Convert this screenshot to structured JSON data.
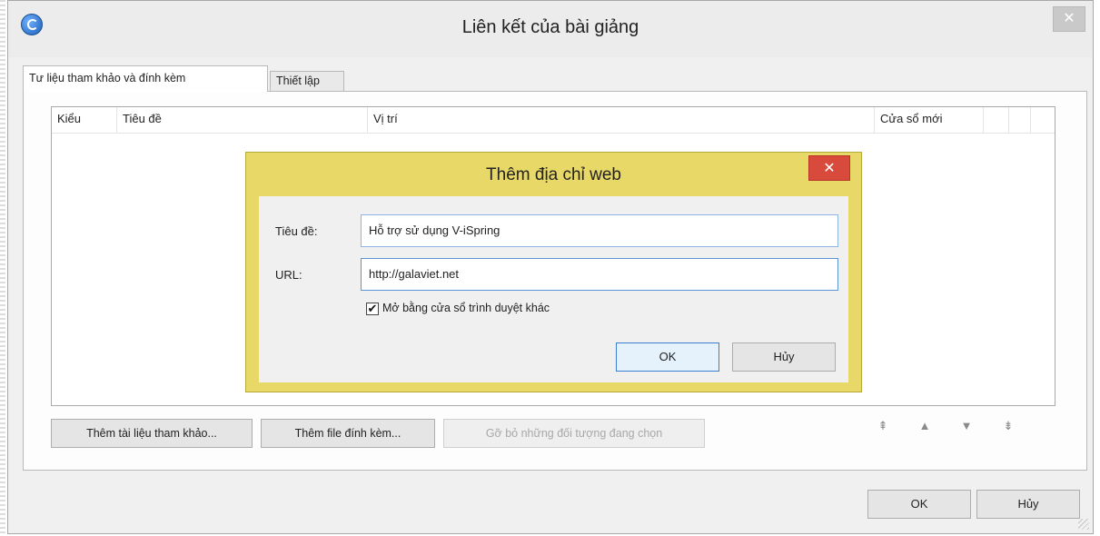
{
  "window": {
    "title": "Liên kết của bài giảng",
    "close_glyph": "✕"
  },
  "tabs": [
    {
      "label": "Tư liệu tham khảo và đính kèm",
      "active": true
    },
    {
      "label": "Thiết lập",
      "active": false
    }
  ],
  "list": {
    "columns": [
      "Kiểu",
      "Tiêu đề",
      "Vị trí",
      "Cửa sổ mới"
    ]
  },
  "actions": {
    "add_reference": "Thêm tài liệu tham khảo...",
    "add_attachment": "Thêm file đính kèm...",
    "remove_selected": "Gỡ bỏ những đối tượng đang chọn"
  },
  "order_icons": [
    "move-top-icon",
    "move-up-icon",
    "move-down-icon",
    "move-bottom-icon"
  ],
  "dialog": {
    "title": "Thêm địa chỉ web",
    "close_glyph": "✕",
    "title_label": "Tiêu đề:",
    "title_value": "Hỗ trợ sử dụng V-iSpring",
    "url_label": "URL:",
    "url_value": "http://galaviet.net",
    "new_window_checked": true,
    "new_window_label": "Mở bằng cửa sổ trình duyệt khác",
    "ok_label": "OK",
    "cancel_label": "Hủy"
  },
  "footer": {
    "ok_label": "OK",
    "cancel_label": "Hủy"
  },
  "colors": {
    "dialog_frame": "#e8d868",
    "dialog_close": "#d84a3b",
    "focus_border": "#3c7fd1"
  }
}
